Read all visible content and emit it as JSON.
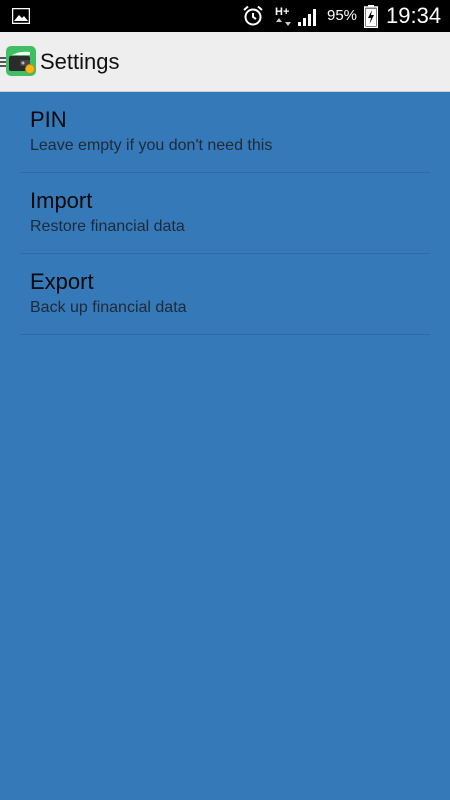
{
  "status_bar": {
    "battery_percent": "95%",
    "time": "19:34",
    "network_label": "H+",
    "icons": [
      "image-icon",
      "alarm-icon",
      "network-type-icon",
      "signal-icon",
      "battery-charging-icon"
    ]
  },
  "action_bar": {
    "title": "Settings",
    "app_icon": "wallet-icon"
  },
  "preferences": [
    {
      "title": "PIN",
      "summary": "Leave empty if you don't need this"
    },
    {
      "title": "Import",
      "summary": "Restore financial data"
    },
    {
      "title": "Export",
      "summary": "Back up financial data"
    }
  ],
  "colors": {
    "background": "#3579b8",
    "action_bar": "#eeeeee",
    "status_bar": "#000000"
  }
}
